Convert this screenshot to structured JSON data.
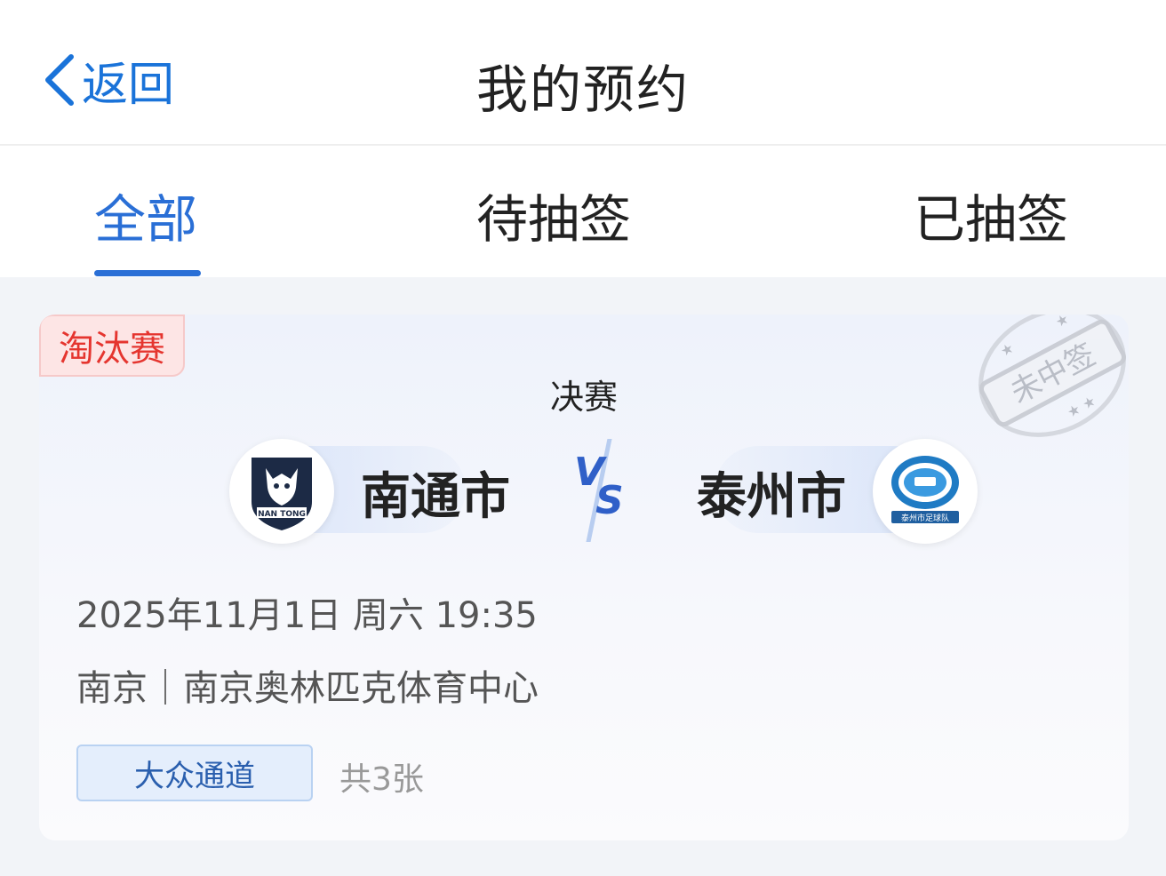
{
  "header": {
    "back_label": "返回",
    "title": "我的预约"
  },
  "tabs": [
    {
      "label": "全部",
      "active": true
    },
    {
      "label": "待抽签",
      "active": false
    },
    {
      "label": "已抽签",
      "active": false
    }
  ],
  "reservation": {
    "stage_badge": "淘汰赛",
    "round": "决赛",
    "home_team": {
      "name": "南通市",
      "logo_text": "NAN TONG"
    },
    "away_team": {
      "name": "泰州市",
      "logo_text": "泰州市足球队"
    },
    "vs_label": "VS",
    "stamp_text": "未中签",
    "datetime": "2025年11月1日 周六 19:35",
    "venue": "南京｜南京奥林匹克体育中心",
    "channel": "大众通道",
    "ticket_count": "共3张"
  },
  "colors": {
    "accent": "#2a6fd6",
    "back_link": "#1a73d9",
    "badge_red": "#e5352f",
    "page_bg": "#f2f4f8"
  },
  "icons": {
    "back": "chevron-left-icon",
    "home_logo": "wolf-crest-icon",
    "away_logo": "football-crest-icon",
    "vs": "vs-lightning-icon",
    "stamp": "not-selected-stamp-icon"
  }
}
